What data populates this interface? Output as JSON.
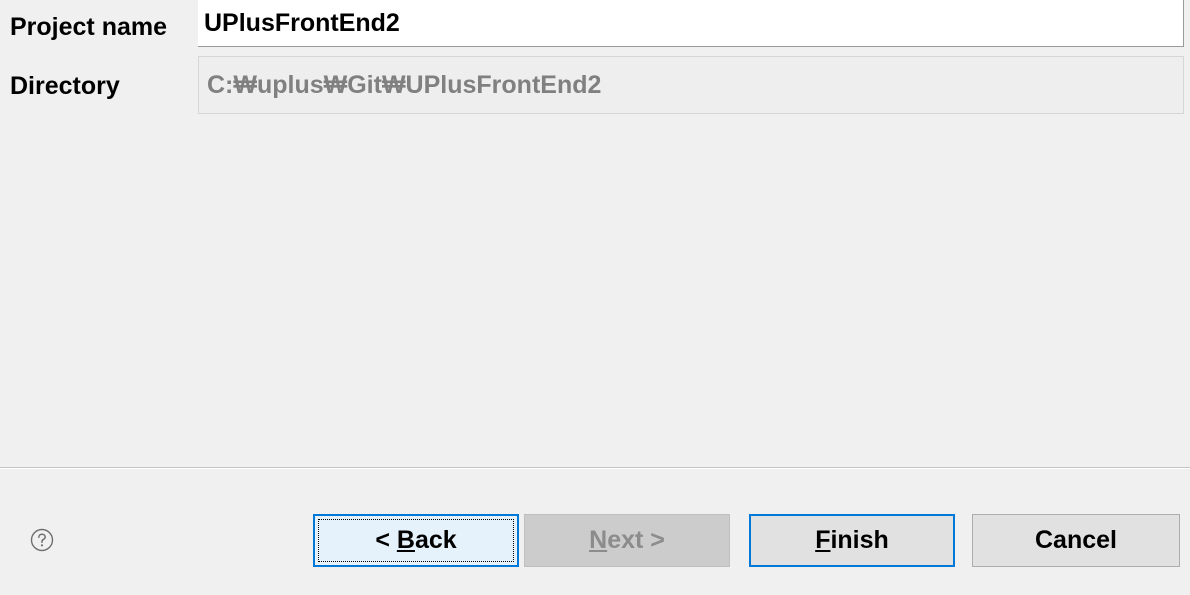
{
  "form": {
    "project_name_label": "Project name",
    "project_name_value": "UPlusFrontEnd2",
    "directory_label": "Directory",
    "directory_value": "C:₩uplus₩Git₩UPlusFrontEnd2"
  },
  "buttons": {
    "back": {
      "prefix": "< ",
      "mnemonic": "B",
      "rest": "ack"
    },
    "next": {
      "mnemonic": "N",
      "rest": "ext >"
    },
    "finish": {
      "mnemonic": "F",
      "rest": "inish"
    },
    "cancel": {
      "label": "Cancel"
    }
  },
  "icons": {
    "help": "help-circle-icon"
  },
  "colors": {
    "background": "#f0f0f0",
    "focus_blue": "#0078d7",
    "disabled_text": "#8c8c8c"
  }
}
